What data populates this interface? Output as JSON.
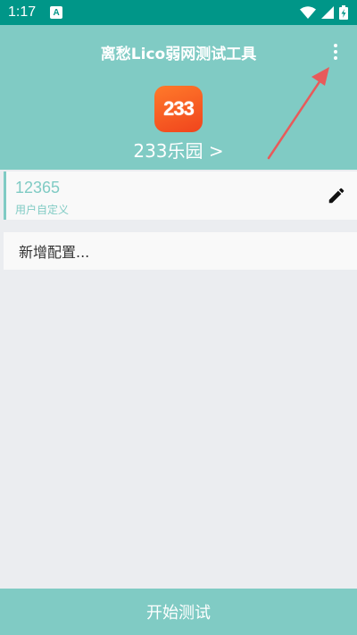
{
  "status_bar": {
    "time": "1:17",
    "notification_icon": "A",
    "icons": [
      "wifi-icon",
      "signal-icon",
      "battery-charging-icon"
    ]
  },
  "header": {
    "title": "离愁Lico弱网测试工具",
    "menu_icon": "more-vert-icon",
    "app": {
      "logo_text": "233",
      "name": "233乐园 >"
    }
  },
  "configs": [
    {
      "name": "12365",
      "subtitle": "用户自定义",
      "action_icon": "edit-pencil-icon"
    }
  ],
  "add_config_label": "新增配置...",
  "start_button_label": "开始测试",
  "colors": {
    "status_bar": "#009688",
    "primary": "#80cbc4",
    "background": "#ebedf0",
    "annotation_arrow": "#e85a5a",
    "logo": "#f55a22"
  }
}
